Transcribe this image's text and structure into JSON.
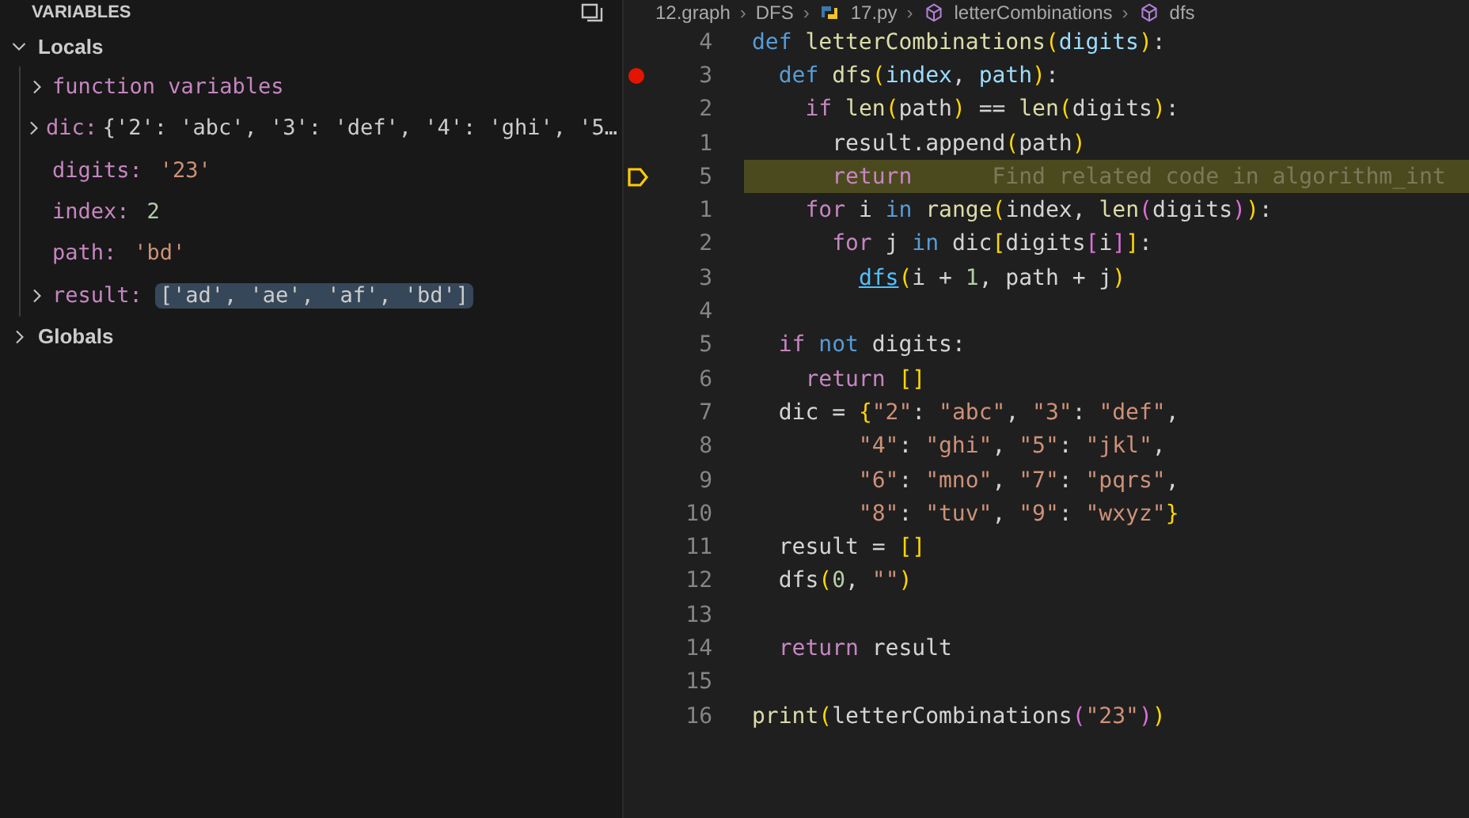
{
  "variables_panel": {
    "title": "VARIABLES",
    "scopes": [
      {
        "label": "Locals",
        "expanded": true,
        "children": [
          {
            "name": "function variables",
            "expandable": true,
            "expanded": false,
            "selected": false
          },
          {
            "name": "dic:",
            "value": "{'2': 'abc', '3': 'def', '4': 'ghi', '5…",
            "kind": "object",
            "expandable": true,
            "expanded": false,
            "selected": false
          },
          {
            "name": "digits:",
            "value": "'23'",
            "kind": "string",
            "expandable": false,
            "selected": false
          },
          {
            "name": "index:",
            "value": "2",
            "kind": "number",
            "expandable": false,
            "selected": false
          },
          {
            "name": "path:",
            "value": "'bd'",
            "kind": "string",
            "expandable": false,
            "selected": false
          },
          {
            "name": "result:",
            "value": "['ad', 'ae', 'af', 'bd']",
            "kind": "object",
            "expandable": true,
            "expanded": false,
            "selected": true
          }
        ]
      },
      {
        "label": "Globals",
        "expanded": false
      }
    ]
  },
  "breadcrumb": [
    {
      "label": "12.graph",
      "kind": "folder"
    },
    {
      "separator": "›",
      "label": "DFS",
      "kind": "folder"
    },
    {
      "separator": "›",
      "label": "17.py",
      "kind": "python-file"
    },
    {
      "separator": "›",
      "label": "letterCombinations",
      "kind": "symbol"
    },
    {
      "separator": "›",
      "label": "dfs",
      "kind": "symbol"
    }
  ],
  "editor": {
    "lines": [
      {
        "number": "4",
        "breakpoint": false,
        "current": false,
        "tokens": [
          {
            "kind": "keyword",
            "text": "def "
          },
          {
            "kind": "function",
            "text": "letterCombinations"
          },
          {
            "kind": "bracket1",
            "text": "("
          },
          {
            "kind": "param",
            "text": "digits"
          },
          {
            "kind": "bracket1",
            "text": ")"
          },
          {
            "kind": "plain",
            "text": ":"
          }
        ]
      },
      {
        "number": "3",
        "breakpoint": true,
        "current": false,
        "tokens": [
          {
            "kind": "keyword",
            "text": "  def "
          },
          {
            "kind": "function",
            "text": "dfs"
          },
          {
            "kind": "bracket1",
            "text": "("
          },
          {
            "kind": "param",
            "text": "index"
          },
          {
            "kind": "plain",
            "text": ", "
          },
          {
            "kind": "param",
            "text": "path"
          },
          {
            "kind": "bracket1",
            "text": ")"
          },
          {
            "kind": "plain",
            "text": ":"
          }
        ]
      },
      {
        "number": "2",
        "breakpoint": false,
        "current": false,
        "tokens": [
          {
            "kind": "control",
            "text": "    if "
          },
          {
            "kind": "function",
            "text": "len"
          },
          {
            "kind": "bracket1",
            "text": "("
          },
          {
            "kind": "plain",
            "text": "path"
          },
          {
            "kind": "bracket1",
            "text": ")"
          },
          {
            "kind": "plain",
            "text": " == "
          },
          {
            "kind": "function",
            "text": "len"
          },
          {
            "kind": "bracket1",
            "text": "("
          },
          {
            "kind": "plain",
            "text": "digits"
          },
          {
            "kind": "bracket1",
            "text": ")"
          },
          {
            "kind": "plain",
            "text": ":"
          }
        ]
      },
      {
        "number": "1",
        "breakpoint": false,
        "current": false,
        "tokens": [
          {
            "kind": "plain",
            "text": "      result.append"
          },
          {
            "kind": "bracket1",
            "text": "("
          },
          {
            "kind": "plain",
            "text": "path"
          },
          {
            "kind": "bracket1",
            "text": ")"
          }
        ]
      },
      {
        "number": "5",
        "breakpoint": false,
        "current": true,
        "tokens": [
          {
            "kind": "control",
            "text": "      return"
          },
          {
            "kind": "hint",
            "text": "      Find related code in algorithm_int"
          }
        ]
      },
      {
        "number": "1",
        "breakpoint": false,
        "current": false,
        "tokens": [
          {
            "kind": "control",
            "text": "    for"
          },
          {
            "kind": "plain",
            "text": " i "
          },
          {
            "kind": "keyword",
            "text": "in "
          },
          {
            "kind": "function",
            "text": "range"
          },
          {
            "kind": "bracket1",
            "text": "("
          },
          {
            "kind": "plain",
            "text": "index, "
          },
          {
            "kind": "function",
            "text": "len"
          },
          {
            "kind": "bracket2",
            "text": "("
          },
          {
            "kind": "plain",
            "text": "digits"
          },
          {
            "kind": "bracket2",
            "text": ")"
          },
          {
            "kind": "bracket1",
            "text": ")"
          },
          {
            "kind": "plain",
            "text": ":"
          }
        ]
      },
      {
        "number": "2",
        "breakpoint": false,
        "current": false,
        "tokens": [
          {
            "kind": "control",
            "text": "      for"
          },
          {
            "kind": "plain",
            "text": " j "
          },
          {
            "kind": "keyword",
            "text": "in"
          },
          {
            "kind": "plain",
            "text": " dic"
          },
          {
            "kind": "bracket1",
            "text": "["
          },
          {
            "kind": "plain",
            "text": "digits"
          },
          {
            "kind": "bracket2",
            "text": "["
          },
          {
            "kind": "plain",
            "text": "i"
          },
          {
            "kind": "bracket2",
            "text": "]"
          },
          {
            "kind": "bracket1",
            "text": "]"
          },
          {
            "kind": "plain",
            "text": ":"
          }
        ]
      },
      {
        "number": "3",
        "breakpoint": false,
        "current": false,
        "tokens": [
          {
            "kind": "link",
            "text": "        dfs"
          },
          {
            "kind": "bracket1",
            "text": "("
          },
          {
            "kind": "plain",
            "text": "i + "
          },
          {
            "kind": "number",
            "text": "1"
          },
          {
            "kind": "plain",
            "text": ", path + j"
          },
          {
            "kind": "bracket1",
            "text": ")"
          }
        ]
      },
      {
        "number": "4",
        "breakpoint": false,
        "current": false
      },
      {
        "number": "5",
        "breakpoint": false,
        "current": false,
        "tokens": [
          {
            "kind": "control",
            "text": "  if "
          },
          {
            "kind": "keyword",
            "text": "not"
          },
          {
            "kind": "plain",
            "text": " digits:"
          }
        ]
      },
      {
        "number": "6",
        "breakpoint": false,
        "current": false,
        "tokens": [
          {
            "kind": "control",
            "text": "    return "
          },
          {
            "kind": "bracket1",
            "text": "[]"
          }
        ]
      },
      {
        "number": "7",
        "breakpoint": false,
        "current": false,
        "tokens": [
          {
            "kind": "plain",
            "text": "  dic = "
          },
          {
            "kind": "bracket1",
            "text": "{"
          },
          {
            "kind": "string",
            "text": "\"2\""
          },
          {
            "kind": "plain",
            "text": ": "
          },
          {
            "kind": "string",
            "text": "\"abc\""
          },
          {
            "kind": "plain",
            "text": ", "
          },
          {
            "kind": "string",
            "text": "\"3\""
          },
          {
            "kind": "plain",
            "text": ": "
          },
          {
            "kind": "string",
            "text": "\"def\""
          },
          {
            "kind": "plain",
            "text": ","
          }
        ]
      },
      {
        "number": "8",
        "breakpoint": false,
        "current": false,
        "tokens": [
          {
            "kind": "string",
            "text": "        \"4\""
          },
          {
            "kind": "plain",
            "text": ": "
          },
          {
            "kind": "string",
            "text": "\"ghi\""
          },
          {
            "kind": "plain",
            "text": ", "
          },
          {
            "kind": "string",
            "text": "\"5\""
          },
          {
            "kind": "plain",
            "text": ": "
          },
          {
            "kind": "string",
            "text": "\"jkl\""
          },
          {
            "kind": "plain",
            "text": ","
          }
        ]
      },
      {
        "number": "9",
        "breakpoint": false,
        "current": false,
        "tokens": [
          {
            "kind": "string",
            "text": "        \"6\""
          },
          {
            "kind": "plain",
            "text": ": "
          },
          {
            "kind": "string",
            "text": "\"mno\""
          },
          {
            "kind": "plain",
            "text": ", "
          },
          {
            "kind": "string",
            "text": "\"7\""
          },
          {
            "kind": "plain",
            "text": ": "
          },
          {
            "kind": "string",
            "text": "\"pqrs\""
          },
          {
            "kind": "plain",
            "text": ","
          }
        ]
      },
      {
        "number": "10",
        "breakpoint": false,
        "current": false,
        "tokens": [
          {
            "kind": "string",
            "text": "        \"8\""
          },
          {
            "kind": "plain",
            "text": ": "
          },
          {
            "kind": "string",
            "text": "\"tuv\""
          },
          {
            "kind": "plain",
            "text": ", "
          },
          {
            "kind": "string",
            "text": "\"9\""
          },
          {
            "kind": "plain",
            "text": ": "
          },
          {
            "kind": "string",
            "text": "\"wxyz\""
          },
          {
            "kind": "bracket1",
            "text": "}"
          }
        ]
      },
      {
        "number": "11",
        "breakpoint": false,
        "current": false,
        "tokens": [
          {
            "kind": "plain",
            "text": "  result = "
          },
          {
            "kind": "bracket1",
            "text": "[]"
          }
        ]
      },
      {
        "number": "12",
        "breakpoint": false,
        "current": false,
        "tokens": [
          {
            "kind": "plain",
            "text": "  dfs"
          },
          {
            "kind": "bracket1",
            "text": "("
          },
          {
            "kind": "number",
            "text": "0"
          },
          {
            "kind": "plain",
            "text": ", "
          },
          {
            "kind": "string",
            "text": "\"\""
          },
          {
            "kind": "bracket1",
            "text": ")"
          }
        ]
      },
      {
        "number": "13",
        "breakpoint": false,
        "current": false
      },
      {
        "number": "14",
        "breakpoint": false,
        "current": false,
        "tokens": [
          {
            "kind": "control",
            "text": "  return"
          },
          {
            "kind": "plain",
            "text": " result"
          }
        ]
      },
      {
        "number": "15",
        "breakpoint": false,
        "current": false
      },
      {
        "number": "16",
        "breakpoint": false,
        "current": false,
        "tokens": [
          {
            "kind": "function",
            "text": "print"
          },
          {
            "kind": "bracket1",
            "text": "("
          },
          {
            "kind": "plain",
            "text": "letterCombinations"
          },
          {
            "kind": "bracket2",
            "text": "("
          },
          {
            "kind": "string",
            "text": "\"23\""
          },
          {
            "kind": "bracket2",
            "text": ")"
          },
          {
            "kind": "bracket1",
            "text": ")"
          }
        ]
      }
    ]
  }
}
